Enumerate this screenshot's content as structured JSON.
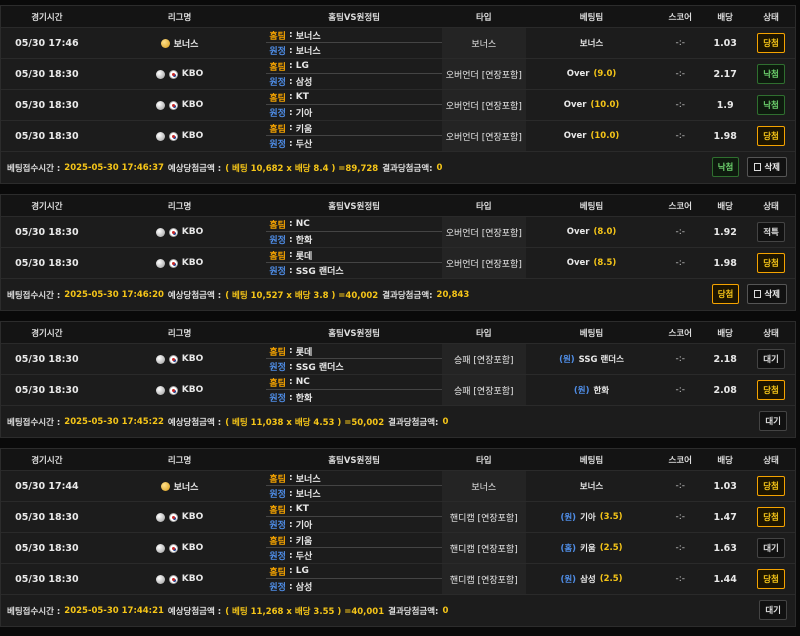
{
  "headers": {
    "time": "경기시간",
    "league": "리그명",
    "teams": "홈팀VS원정팀",
    "type": "타입",
    "bet": "베팅팀",
    "score": "스코어",
    "odds": "배당",
    "state": "상태"
  },
  "labels": {
    "home": "홈팀",
    "away": "원정",
    "sep": " : ",
    "footer_time": "베팅접수시간 :",
    "footer_expected": "예상당첨금액 :",
    "footer_result": "결과당첨금액:",
    "delete": "삭제"
  },
  "colors": {
    "home": "#f5a300",
    "away": "#4f8de6",
    "accent": "#f5c518",
    "lose": "#6cd06c"
  },
  "slips": [
    {
      "rows": [
        {
          "time": "05/30 17:46",
          "league_icon": "bonus-ball",
          "league": "보너스",
          "home": "보너스",
          "away": "보너스",
          "type": "보너스",
          "bet_pick": "",
          "bet_team": "보너스",
          "bet_line": "",
          "score": "-:-",
          "odds": "1.03",
          "state": "당첨",
          "state_kind": "win"
        },
        {
          "time": "05/30 18:30",
          "league_icon": "baseball-kr",
          "league": "KBO",
          "home": "LG",
          "away": "삼성",
          "type": "오버언더 [연장포함]",
          "bet_pick": "",
          "bet_team": "Over",
          "bet_line": "(9.0)",
          "score": "-:-",
          "odds": "2.17",
          "state": "낙첨",
          "state_kind": "lose"
        },
        {
          "time": "05/30 18:30",
          "league_icon": "baseball-kr",
          "league": "KBO",
          "home": "KT",
          "away": "기아",
          "type": "오버언더 [연장포함]",
          "bet_pick": "",
          "bet_team": "Over",
          "bet_line": "(10.0)",
          "score": "-:-",
          "odds": "1.9",
          "state": "낙첨",
          "state_kind": "lose"
        },
        {
          "time": "05/30 18:30",
          "league_icon": "baseball-kr",
          "league": "KBO",
          "home": "키움",
          "away": "두산",
          "type": "오버언더 [연장포함]",
          "bet_pick": "",
          "bet_team": "Over",
          "bet_line": "(10.0)",
          "score": "-:-",
          "odds": "1.98",
          "state": "당첨",
          "state_kind": "win"
        }
      ],
      "footer": {
        "time": "2025-05-30 17:46:37",
        "expected": "( 베팅 10,682 x 배당 8.4 ) =89,728",
        "result": "0"
      },
      "actions": [
        {
          "label": "낙첨",
          "kind": "lose"
        },
        {
          "label": "삭제",
          "kind": "delete"
        }
      ]
    },
    {
      "rows": [
        {
          "time": "05/30 18:30",
          "league_icon": "baseball-kr",
          "league": "KBO",
          "home": "NC",
          "away": "한화",
          "type": "오버언더 [연장포함]",
          "bet_pick": "",
          "bet_team": "Over",
          "bet_line": "(8.0)",
          "score": "-:-",
          "odds": "1.92",
          "state": "적특",
          "state_kind": "neutral"
        },
        {
          "time": "05/30 18:30",
          "league_icon": "baseball-kr",
          "league": "KBO",
          "home": "롯데",
          "away": "SSG 랜더스",
          "type": "오버언더 [연장포함]",
          "bet_pick": "",
          "bet_team": "Over",
          "bet_line": "(8.5)",
          "score": "-:-",
          "odds": "1.98",
          "state": "당첨",
          "state_kind": "win"
        }
      ],
      "footer": {
        "time": "2025-05-30 17:46:20",
        "expected": "( 베팅 10,527 x 배당 3.8 ) =40,002",
        "result": "20,843"
      },
      "actions": [
        {
          "label": "당첨",
          "kind": "win"
        },
        {
          "label": "삭제",
          "kind": "delete"
        }
      ]
    },
    {
      "rows": [
        {
          "time": "05/30 18:30",
          "league_icon": "baseball-kr",
          "league": "KBO",
          "home": "롯데",
          "away": "SSG 랜더스",
          "type": "승패 [연장포함]",
          "bet_pick": "(원)",
          "bet_team": "SSG 랜더스",
          "bet_line": "",
          "score": "-:-",
          "odds": "2.18",
          "state": "대기",
          "state_kind": "neutral"
        },
        {
          "time": "05/30 18:30",
          "league_icon": "baseball-kr",
          "league": "KBO",
          "home": "NC",
          "away": "한화",
          "type": "승패 [연장포함]",
          "bet_pick": "(원)",
          "bet_team": "한화",
          "bet_line": "",
          "score": "-:-",
          "odds": "2.08",
          "state": "당첨",
          "state_kind": "win"
        }
      ],
      "footer": {
        "time": "2025-05-30 17:45:22",
        "expected": "( 베팅 11,038 x 배당 4.53 ) =50,002",
        "result": "0"
      },
      "actions": [
        {
          "label": "대기",
          "kind": "neutral"
        }
      ]
    },
    {
      "rows": [
        {
          "time": "05/30 17:44",
          "league_icon": "bonus-ball",
          "league": "보너스",
          "home": "보너스",
          "away": "보너스",
          "type": "보너스",
          "bet_pick": "",
          "bet_team": "보너스",
          "bet_line": "",
          "score": "-:-",
          "odds": "1.03",
          "state": "당첨",
          "state_kind": "win"
        },
        {
          "time": "05/30 18:30",
          "league_icon": "baseball-kr",
          "league": "KBO",
          "home": "KT",
          "away": "기아",
          "type": "핸디캡 [연장포함]",
          "bet_pick": "(원)",
          "bet_team": "기아",
          "bet_line": "(3.5)",
          "score": "-:-",
          "odds": "1.47",
          "state": "당첨",
          "state_kind": "win"
        },
        {
          "time": "05/30 18:30",
          "league_icon": "baseball-kr",
          "league": "KBO",
          "home": "키움",
          "away": "두산",
          "type": "핸디캡 [연장포함]",
          "bet_pick": "(홈)",
          "bet_team": "키움",
          "bet_line": "(2.5)",
          "score": "-:-",
          "odds": "1.63",
          "state": "대기",
          "state_kind": "neutral"
        },
        {
          "time": "05/30 18:30",
          "league_icon": "baseball-kr",
          "league": "KBO",
          "home": "LG",
          "away": "삼성",
          "type": "핸디캡 [연장포함]",
          "bet_pick": "(원)",
          "bet_team": "삼성",
          "bet_line": "(2.5)",
          "score": "-:-",
          "odds": "1.44",
          "state": "당첨",
          "state_kind": "win"
        }
      ],
      "footer": {
        "time": "2025-05-30 17:44:21",
        "expected": "( 베팅 11,268 x 배당 3.55 ) =40,001",
        "result": "0"
      },
      "actions": [
        {
          "label": "대기",
          "kind": "neutral"
        }
      ]
    }
  ]
}
